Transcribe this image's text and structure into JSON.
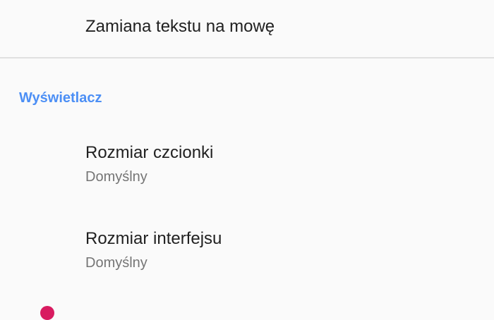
{
  "settings": {
    "text_to_speech": {
      "title": "Zamiana tekstu na mowę"
    },
    "display_section": {
      "header": "Wyświetlacz",
      "items": [
        {
          "title": "Rozmiar czcionki",
          "summary": "Domyślny"
        },
        {
          "title": "Rozmiar interfejsu",
          "summary": "Domyślny"
        }
      ]
    }
  },
  "colors": {
    "accent": "#4c8ff5",
    "primary_text": "#212121",
    "secondary_text": "#757575",
    "divider": "#e0e0e0",
    "background": "#fafafa",
    "partial_icon": "#d81b60"
  }
}
